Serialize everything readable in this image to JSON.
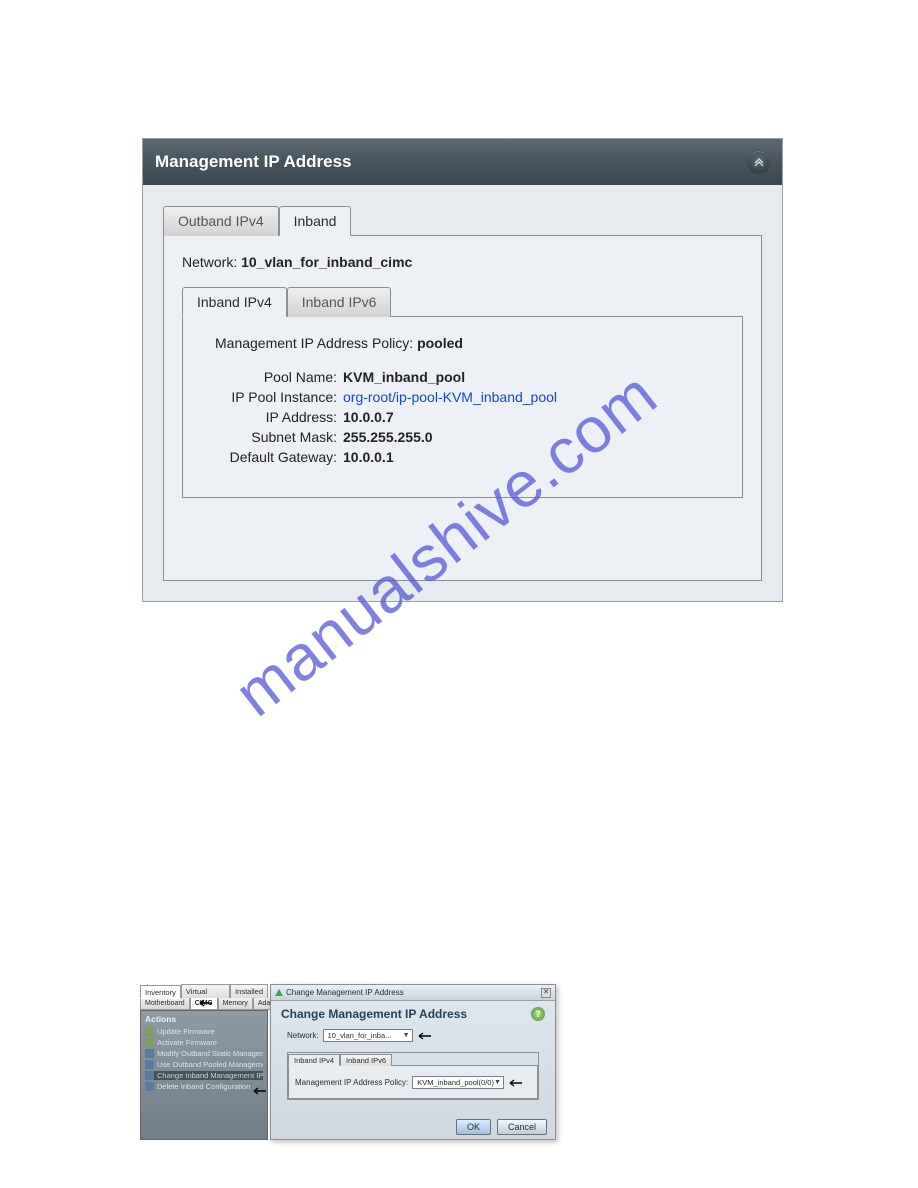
{
  "watermark_text": "manualshive.com",
  "panel1": {
    "title": "Management IP Address",
    "outer_tabs": [
      {
        "label": "Outband IPv4",
        "active": false
      },
      {
        "label": "Inband",
        "active": true
      }
    ],
    "network_label": "Network:",
    "network_value": "10_vlan_for_inband_cimc",
    "inner_tabs": [
      {
        "label": "Inband IPv4",
        "active": true
      },
      {
        "label": "Inband IPv6",
        "active": false
      }
    ],
    "policy_label": "Management IP Address Policy:",
    "policy_value": "pooled",
    "rows": [
      {
        "k": "Pool Name:",
        "v": "KVM_inband_pool",
        "link": false
      },
      {
        "k": "IP Pool Instance:",
        "v": "org-root/ip-pool-KVM_inband_pool",
        "link": true
      },
      {
        "k": "IP Address:",
        "v": "10.0.0.7",
        "link": false
      },
      {
        "k": "Subnet Mask:",
        "v": "255.255.255.0",
        "link": false
      },
      {
        "k": "Default Gateway:",
        "v": "10.0.0.1",
        "link": false
      }
    ]
  },
  "composite": {
    "top_tabs": [
      "Inventory",
      "Virtual Machines",
      "Installed F"
    ],
    "sub_tabs": [
      "Motherboard",
      "CIMC",
      "Memory",
      "Adapters"
    ],
    "actions_title": "Actions",
    "actions": [
      {
        "label": "Update Firmware",
        "icon": "g"
      },
      {
        "label": "Activate Firmware",
        "icon": "g"
      },
      {
        "label": "Modify Outband Static Management IP",
        "icon": "b"
      },
      {
        "label": "Use Outband Pooled Management IP",
        "icon": "b"
      },
      {
        "label": "Change Inband Management IP",
        "icon": "b",
        "selected": true
      },
      {
        "label": "Delete Inband Configuration",
        "icon": "b"
      }
    ],
    "dialog": {
      "tb_title": "Change Management IP Address",
      "heading": "Change Management IP Address",
      "network_label": "Network:",
      "network_value": "10_vlan_for_inba...",
      "inner_tabs": [
        "Inband IPv4",
        "Inband IPv6"
      ],
      "policy_label": "Management IP Address Policy:",
      "policy_value": "KVM_inband_pool(0/0)",
      "ok": "OK",
      "cancel": "Cancel"
    }
  }
}
